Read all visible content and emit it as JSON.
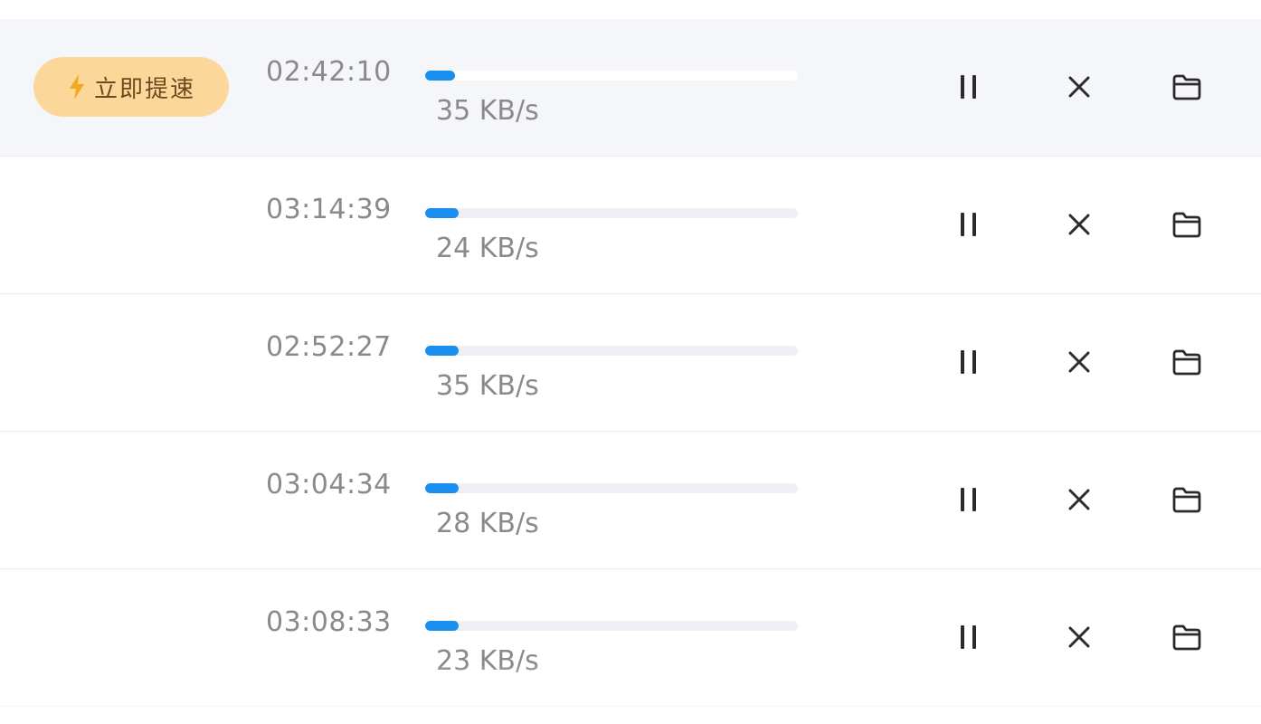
{
  "boost": {
    "label": "立即提速",
    "icon": "lightning-icon",
    "color": "#fbd89a",
    "icon_color": "#f5a623"
  },
  "accent_color": "#1a8ff0",
  "downloads": [
    {
      "time_remaining": "02:42:10",
      "speed": "35 KB/s",
      "progress": 0.08,
      "highlighted": true
    },
    {
      "time_remaining": "03:14:39",
      "speed": "24 KB/s",
      "progress": 0.09,
      "highlighted": false
    },
    {
      "time_remaining": "02:52:27",
      "speed": "35 KB/s",
      "progress": 0.09,
      "highlighted": false
    },
    {
      "time_remaining": "03:04:34",
      "speed": "28 KB/s",
      "progress": 0.09,
      "highlighted": false
    },
    {
      "time_remaining": "03:08:33",
      "speed": "23 KB/s",
      "progress": 0.09,
      "highlighted": false
    }
  ],
  "actions": {
    "pause_icon": "pause-icon",
    "cancel_icon": "close-icon",
    "folder_icon": "folder-icon"
  }
}
